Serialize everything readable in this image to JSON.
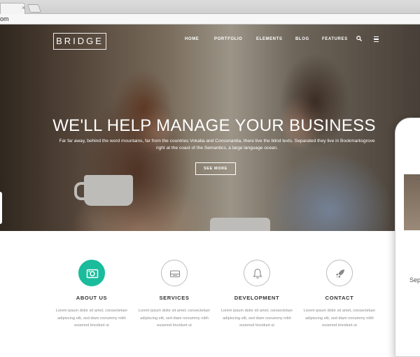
{
  "browser": {
    "url_fragment": "om"
  },
  "site": {
    "logo": "BRIDGE",
    "nav": [
      "HOME",
      "PORTFOLIO",
      "ELEMENTS",
      "BLOG",
      "FEATURES"
    ]
  },
  "hero": {
    "headline": "WE'LL HELP MANAGE YOUR BUSINESS",
    "subtext": "Far far away, behind the word mountains, far from the countries Vokalia and Consonantia, there live the blind texts. Separated they live in Bookmarksgrove right at the coast of the Semantics, a large language ocean.",
    "button": "SEE MORE"
  },
  "features": [
    {
      "title": "ABOUT US",
      "icon": "image-icon",
      "text": "Lorem ipsum dolor sit amet, consectetuer adipiscing elit, sed diam nonummy nibh euismod tincidunt ut"
    },
    {
      "title": "SERVICES",
      "icon": "inbox-icon",
      "text": "Lorem ipsum dolor sit amet, consectetuer adipiscing elit, sed diam nonummy nibh euismod tincidunt ut"
    },
    {
      "title": "DEVELOPMENT",
      "icon": "bell-icon",
      "text": "Lorem ipsum dolor sit amet, consectetuer adipiscing elit, sed diam nonummy nibh euismod tincidunt ut"
    },
    {
      "title": "CONTACT",
      "icon": "rocket-icon",
      "text": "Lorem ipsum dolor sit amet, consectetuer adipiscing elit, sed diam nonummy nibh euismod tincidunt ut"
    }
  ],
  "phone": {
    "partial_text": "Sep"
  },
  "colors": {
    "accent": "#1abc9c"
  }
}
